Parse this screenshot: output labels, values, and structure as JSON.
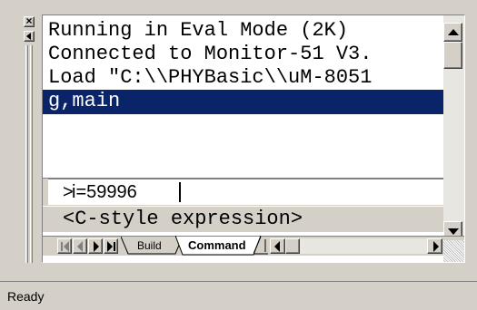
{
  "output": {
    "lines": [
      "Running in Eval Mode (2K)",
      "Connected to Monitor-51 V3.",
      "Load \"C:\\\\PHYBasic\\\\uM-8051",
      "g,main"
    ],
    "selected_index": 3,
    "selection_color": "#0a246a"
  },
  "command": {
    "prompt": ">",
    "value": "i=59996"
  },
  "hint": {
    "text": "<C-style expression>"
  },
  "tabs": [
    {
      "label": "Build",
      "active": false
    },
    {
      "label": "Command",
      "active": true
    }
  ],
  "statusbar": {
    "text": "Ready"
  },
  "icons": {
    "close": "close-icon",
    "restore": "restore-icon",
    "scroll_up": "arrow-up-icon",
    "scroll_down": "arrow-down-icon",
    "tab_first": "first-tab-icon",
    "tab_prev": "prev-tab-icon",
    "tab_next": "next-tab-icon",
    "tab_last": "last-tab-icon",
    "hscroll_left": "arrow-left-icon",
    "hscroll_right": "arrow-right-icon"
  }
}
